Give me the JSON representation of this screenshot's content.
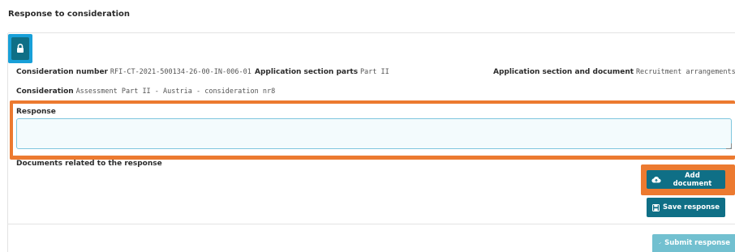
{
  "page": {
    "title": "Response to consideration"
  },
  "lock_icon": "lock-icon",
  "meta": {
    "consideration_number_label": "Consideration number",
    "consideration_number_value": "RFI-CT-2021-500134-26-00-IN-006-01",
    "section_parts_label": "Application section parts",
    "section_parts_value": "Part II",
    "section_document_label": "Application section and document",
    "section_document_value": "Recruitment arrangements",
    "consideration_label": "Consideration",
    "consideration_value": "Assessment Part II - Austria - consideration nr8"
  },
  "response": {
    "label": "Response",
    "value": ""
  },
  "documents": {
    "label": "Documents related to the response"
  },
  "buttons": {
    "add_document": "Add document",
    "save_response": "Save response",
    "submit_response": "Submit response"
  },
  "colors": {
    "primary": "#0f6f86",
    "primary_disabled": "#72c0d0",
    "highlight_orange": "#ec7a30",
    "highlight_blue": "#18a0d8"
  }
}
